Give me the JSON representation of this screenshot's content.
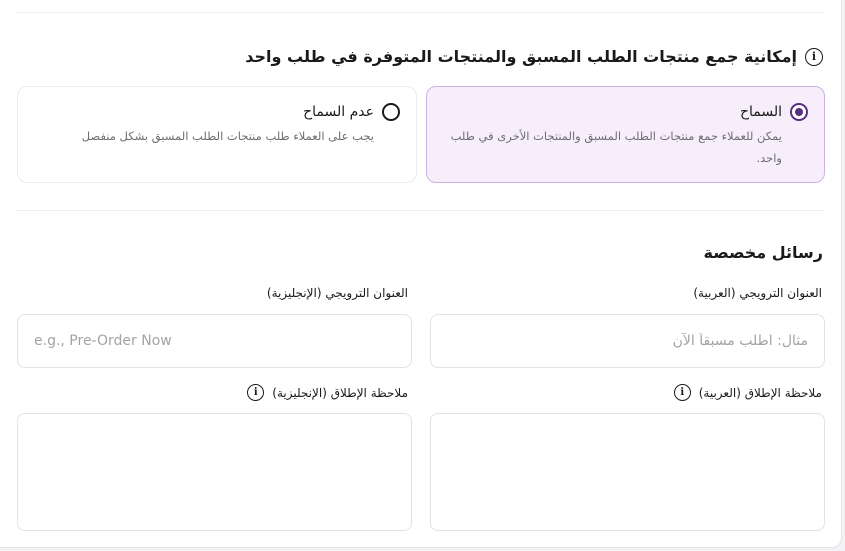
{
  "combine": {
    "heading": "إمكانية جمع منتجات الطلب المسبق والمنتجات المتوفرة في طلب واحد",
    "options": [
      {
        "label": "السماح",
        "description": "يمكن للعملاء جمع منتجات الطلب المسبق والمنتجات الأخرى في طلب واحد.",
        "selected": true
      },
      {
        "label": "عدم السماح",
        "description": "يجب على العملاء طلب منتجات الطلب المسبق بشكل منفصل",
        "selected": false
      }
    ]
  },
  "custom_messages": {
    "heading": "رسائل مخصصة",
    "promo_title_ar": {
      "label": "العنوان الترويجي (العربية)",
      "placeholder": "مثال: اطلب مسبقاً الآن",
      "value": ""
    },
    "promo_title_en": {
      "label": "العنوان الترويجي (الإنجليزية)",
      "placeholder": "e.g., Pre-Order Now",
      "value": ""
    },
    "launch_note_ar": {
      "label": "ملاحظة الإطلاق (العربية)",
      "value": ""
    },
    "launch_note_en": {
      "label": "ملاحظة الإطلاق (الإنجليزية)",
      "value": ""
    }
  },
  "icons": {
    "info": "info-icon"
  },
  "colors": {
    "accent": "#5a2d82",
    "selected_bg": "#f6eefb",
    "selected_border": "#cdb3e2"
  }
}
